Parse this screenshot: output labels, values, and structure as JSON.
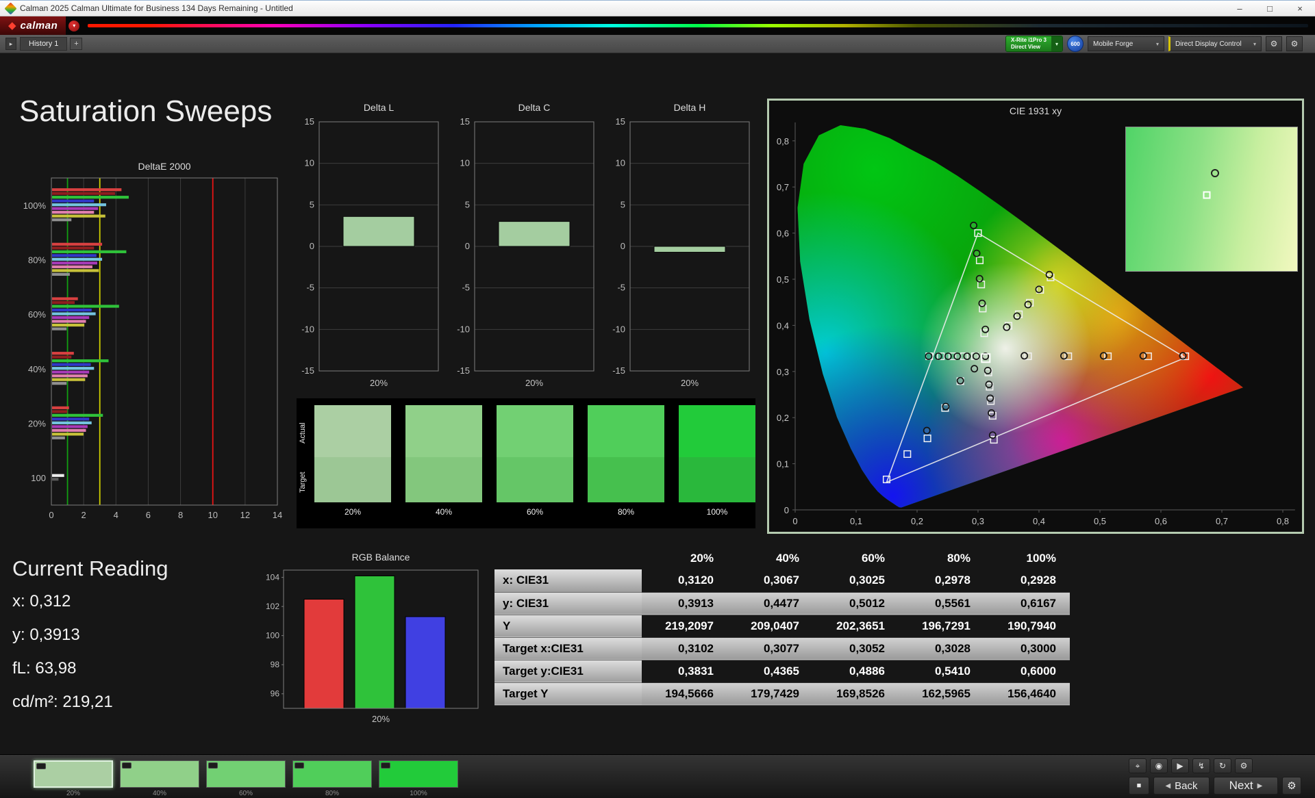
{
  "window": {
    "title": "Calman 2025 Calman Ultimate for Business 134 Days Remaining - Untitled",
    "minimize": "–",
    "maximize": "□",
    "close": "×"
  },
  "icons": {
    "caret": "▾",
    "diamond": "◆",
    "stop": "■",
    "back": "◀",
    "next": "▶",
    "gear": "⚙",
    "plus": "+",
    "tab_arrow": "▸"
  },
  "brand": {
    "logo": "calman"
  },
  "toolbar": {
    "history_tab": "History 1",
    "meter_line1": "X-Rite i1Pro 3",
    "meter_line2": "Direct View",
    "badge": "600",
    "pattern_source": "Mobile Forge",
    "display_control": "Direct Display Control"
  },
  "page_title": "Saturation Sweeps",
  "current_reading": {
    "title": "Current Reading",
    "lines": [
      "x: 0,312",
      "y: 0,3913",
      "fL: 63,98",
      "cd/m²: 219,21"
    ]
  },
  "patches": {
    "actual_label": "Actual",
    "target_label": "Target",
    "items": [
      {
        "label": "20%",
        "actual": "#abcfa3",
        "target": "#9cc795"
      },
      {
        "label": "40%",
        "actual": "#90d089",
        "target": "#83c77d"
      },
      {
        "label": "60%",
        "actual": "#72d073",
        "target": "#65c667"
      },
      {
        "label": "80%",
        "actual": "#50ce5a",
        "target": "#46c04e"
      },
      {
        "label": "100%",
        "actual": "#22cb3a",
        "target": "#2ab83c"
      }
    ]
  },
  "table": {
    "columns": [
      "20%",
      "40%",
      "60%",
      "80%",
      "100%"
    ],
    "rows": [
      {
        "label": "x: CIE31",
        "shaded": false,
        "values": [
          "0,3120",
          "0,3067",
          "0,3025",
          "0,2978",
          "0,2928"
        ]
      },
      {
        "label": "y: CIE31",
        "shaded": true,
        "values": [
          "0,3913",
          "0,4477",
          "0,5012",
          "0,5561",
          "0,6167"
        ]
      },
      {
        "label": "Y",
        "shaded": false,
        "values": [
          "219,2097",
          "209,0407",
          "202,3651",
          "196,7291",
          "190,7940"
        ]
      },
      {
        "label": "Target x:CIE31",
        "shaded": true,
        "values": [
          "0,3102",
          "0,3077",
          "0,3052",
          "0,3028",
          "0,3000"
        ]
      },
      {
        "label": "Target y:CIE31",
        "shaded": false,
        "values": [
          "0,3831",
          "0,4365",
          "0,4886",
          "0,5410",
          "0,6000"
        ]
      },
      {
        "label": "Target Y",
        "shaded": true,
        "values": [
          "194,5666",
          "179,7429",
          "169,8526",
          "162,5965",
          "156,4640"
        ]
      }
    ]
  },
  "bottom_bar": {
    "swatches": [
      {
        "label": "20%",
        "color": "#abcfa3",
        "selected": true
      },
      {
        "label": "40%",
        "color": "#90d089",
        "selected": false
      },
      {
        "label": "60%",
        "color": "#72d073",
        "selected": false
      },
      {
        "label": "80%",
        "color": "#50ce5a",
        "selected": false
      },
      {
        "label": "100%",
        "color": "#22cb3a",
        "selected": false
      }
    ],
    "transport": [
      {
        "name": "target-icon",
        "glyph": "⌖"
      },
      {
        "name": "record-icon",
        "glyph": "◉"
      },
      {
        "name": "play-icon",
        "glyph": "▶"
      },
      {
        "name": "flash-icon",
        "glyph": "↯"
      },
      {
        "name": "refresh-icon",
        "glyph": "↻"
      },
      {
        "name": "settings-icon",
        "glyph": "⚙"
      }
    ],
    "back": "Back",
    "next": "Next"
  },
  "chart_data": [
    {
      "id": "deltaE2000",
      "type": "bar",
      "orientation": "horizontal",
      "title": "DeltaE 2000",
      "xlim": [
        0,
        14
      ],
      "xticks": [
        0,
        2,
        4,
        6,
        8,
        10,
        12,
        14
      ],
      "reference_lines": [
        {
          "value": 1,
          "color": "#12a012"
        },
        {
          "value": 3,
          "color": "#cfcf00"
        },
        {
          "value": 10,
          "color": "#e81414"
        }
      ],
      "palette": [
        "#d84040",
        "#8f1f1f",
        "#2fc23a",
        "#3038c8",
        "#74c4e0",
        "#a83ab8",
        "#e080ae",
        "#c8c23a",
        "#909090"
      ],
      "groups": [
        {
          "label": "100%",
          "values": [
            4.3,
            3.9,
            4.75,
            2.6,
            3.35,
            2.85,
            2.6,
            3.3,
            1.2
          ]
        },
        {
          "label": "80%",
          "values": [
            3.1,
            2.6,
            4.6,
            2.75,
            3.1,
            2.8,
            2.5,
            2.9,
            1.1
          ]
        },
        {
          "label": "60%",
          "values": [
            1.6,
            1.4,
            4.15,
            2.45,
            2.7,
            2.3,
            2.1,
            2.0,
            0.9
          ]
        },
        {
          "label": "40%",
          "values": [
            1.35,
            1.2,
            3.5,
            2.4,
            2.6,
            2.3,
            2.2,
            2.05,
            0.9
          ]
        },
        {
          "label": "20%",
          "values": [
            1.05,
            0.95,
            3.15,
            2.3,
            2.45,
            2.2,
            2.1,
            1.95,
            0.8
          ]
        },
        {
          "label": "100",
          "colors": [
            "#ececec",
            "#5a5a5a"
          ],
          "values": [
            0.75,
            0.4
          ]
        }
      ]
    },
    {
      "id": "deltaL",
      "type": "bar",
      "title": "Delta L",
      "categories": [
        "20%"
      ],
      "values": [
        3.6
      ],
      "ylim": [
        -15,
        15
      ],
      "yticks": [
        15,
        10,
        5,
        0,
        -5,
        -10,
        -15
      ],
      "bar_color": "#a4cda0"
    },
    {
      "id": "deltaC",
      "type": "bar",
      "title": "Delta C",
      "categories": [
        "20%"
      ],
      "values": [
        3.0
      ],
      "ylim": [
        -15,
        15
      ],
      "yticks": [
        15,
        10,
        5,
        0,
        -5,
        -10,
        -15
      ],
      "bar_color": "#a4cda0"
    },
    {
      "id": "deltaH",
      "type": "bar",
      "title": "Delta H",
      "categories": [
        "20%"
      ],
      "values": [
        -0.7
      ],
      "ylim": [
        -15,
        15
      ],
      "yticks": [
        15,
        10,
        5,
        0,
        -5,
        -10,
        -15
      ],
      "bar_color": "#a4cda0"
    },
    {
      "id": "rgbBalance",
      "type": "bar",
      "title": "RGB Balance",
      "categories": [
        "20%"
      ],
      "ylim": [
        95,
        104.5
      ],
      "yticks": [
        104,
        102,
        100,
        98,
        96
      ],
      "series": [
        {
          "name": "Red",
          "color": "#e23b3b",
          "value": 102.5
        },
        {
          "name": "Green",
          "color": "#2fc23a",
          "value": 104.1
        },
        {
          "name": "Blue",
          "color": "#4040e2",
          "value": 101.3
        }
      ]
    },
    {
      "id": "cie1931",
      "type": "scatter",
      "title": "CIE 1931 xy",
      "xlim": [
        0,
        0.85
      ],
      "ylim": [
        0,
        0.88
      ],
      "tick_values": [
        0,
        0.1,
        0.2,
        0.3,
        0.4,
        0.5,
        0.6,
        0.7,
        0.8
      ],
      "tick_labels": [
        "0",
        "0,1",
        "0,2",
        "0,3",
        "0,4",
        "0,5",
        "0,6",
        "0,7",
        "0,8"
      ],
      "gamut_triangle": [
        [
          0.64,
          0.33
        ],
        [
          0.3,
          0.6
        ],
        [
          0.15,
          0.06
        ]
      ],
      "white_point": [
        0.3127,
        0.329
      ],
      "measured": {
        "green": [
          [
            0.312,
            0.3913
          ],
          [
            0.3067,
            0.4477
          ],
          [
            0.3025,
            0.5012
          ],
          [
            0.2978,
            0.5561
          ],
          [
            0.2928,
            0.6167
          ]
        ],
        "cyan": [
          [
            0.312,
            0.333
          ],
          [
            0.297,
            0.333
          ],
          [
            0.282,
            0.333
          ],
          [
            0.266,
            0.333
          ],
          [
            0.251,
            0.333
          ],
          [
            0.235,
            0.333
          ],
          [
            0.219,
            0.333
          ]
        ],
        "red": [
          [
            0.376,
            0.334
          ],
          [
            0.441,
            0.334
          ],
          [
            0.506,
            0.334
          ],
          [
            0.571,
            0.334
          ],
          [
            0.636,
            0.334
          ]
        ],
        "yellow": [
          [
            0.347,
            0.396
          ],
          [
            0.364,
            0.42
          ],
          [
            0.382,
            0.445
          ],
          [
            0.4,
            0.478
          ],
          [
            0.417,
            0.51
          ]
        ],
        "magenta": [
          [
            0.316,
            0.302
          ],
          [
            0.318,
            0.272
          ],
          [
            0.32,
            0.242
          ],
          [
            0.322,
            0.21
          ],
          [
            0.324,
            0.162
          ]
        ],
        "blue": [
          [
            0.294,
            0.306
          ],
          [
            0.271,
            0.28
          ],
          [
            0.247,
            0.224
          ],
          [
            0.216,
            0.172
          ]
        ]
      },
      "targets": {
        "green": [
          [
            0.3102,
            0.3831
          ],
          [
            0.3077,
            0.4365
          ],
          [
            0.3052,
            0.4886
          ],
          [
            0.3028,
            0.541
          ],
          [
            0.3,
            0.6
          ]
        ],
        "cyan": [
          [
            0.295,
            0.333
          ],
          [
            0.277,
            0.333
          ],
          [
            0.258,
            0.333
          ],
          [
            0.239,
            0.333
          ],
          [
            0.22,
            0.333
          ]
        ],
        "red": [
          [
            0.382,
            0.333
          ],
          [
            0.448,
            0.333
          ],
          [
            0.513,
            0.333
          ],
          [
            0.579,
            0.333
          ],
          [
            0.64,
            0.333
          ]
        ],
        "yellow": [
          [
            0.35,
            0.399
          ],
          [
            0.367,
            0.424
          ],
          [
            0.385,
            0.449
          ],
          [
            0.402,
            0.477
          ],
          [
            0.419,
            0.504
          ]
        ],
        "magenta": [
          [
            0.317,
            0.298
          ],
          [
            0.319,
            0.267
          ],
          [
            0.321,
            0.236
          ],
          [
            0.324,
            0.204
          ],
          [
            0.326,
            0.152
          ]
        ],
        "blue": [
          [
            0.271,
            0.279
          ],
          [
            0.246,
            0.221
          ],
          [
            0.217,
            0.155
          ],
          [
            0.184,
            0.121
          ],
          [
            0.15,
            0.066
          ]
        ]
      },
      "inset": {
        "circle": [
          0.52,
          0.32
        ],
        "square": [
          0.47,
          0.47
        ]
      }
    }
  ]
}
